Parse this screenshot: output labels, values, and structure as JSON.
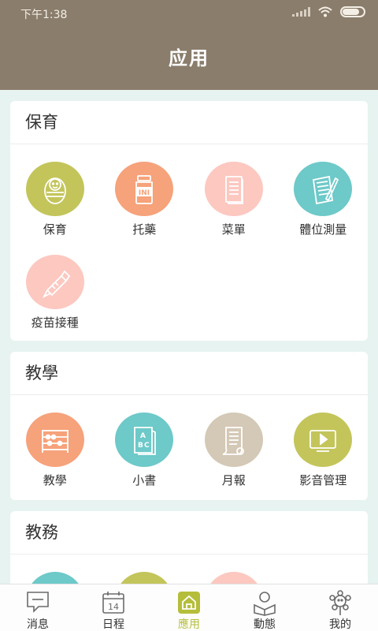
{
  "status": {
    "time": "下午1:38"
  },
  "header": {
    "title": "应用"
  },
  "colors": {
    "header_bg": "#8a7d6c",
    "lime": "#c3c55b",
    "orange": "#f6a27b",
    "pink": "#fcc8c0",
    "teal": "#6ec9c9",
    "beige": "#d4c8b6",
    "active_tab": "#b5be3a"
  },
  "sections": [
    {
      "title": "保育",
      "items": [
        {
          "label": "保育",
          "icon": "baby-icon",
          "color": "#c3c55b"
        },
        {
          "label": "托藥",
          "icon": "medicine-bottle-icon",
          "color": "#f6a27b"
        },
        {
          "label": "菜單",
          "icon": "menu-book-icon",
          "color": "#fcc8c0"
        },
        {
          "label": "體位測量",
          "icon": "measure-notepad-icon",
          "color": "#6ec9c9"
        },
        {
          "label": "疫苗接種",
          "icon": "vaccine-icon",
          "color": "#fcc8c0"
        }
      ]
    },
    {
      "title": "教學",
      "items": [
        {
          "label": "教學",
          "icon": "abacus-icon",
          "color": "#f6a27b"
        },
        {
          "label": "小書",
          "icon": "abc-book-icon",
          "color": "#6ec9c9"
        },
        {
          "label": "月報",
          "icon": "scroll-report-icon",
          "color": "#d4c8b6"
        },
        {
          "label": "影音管理",
          "icon": "video-icon",
          "color": "#c3c55b"
        }
      ]
    },
    {
      "title": "教務",
      "items": [
        {
          "icon": "teal-app-icon",
          "color": "#6ec9c9"
        },
        {
          "icon": "lime-app-icon",
          "color": "#c3c55b"
        },
        {
          "icon": "pink-app-icon",
          "color": "#fcc8c0"
        }
      ]
    }
  ],
  "tabs": [
    {
      "label": "消息",
      "icon": "message-icon"
    },
    {
      "label": "日程",
      "icon": "calendar-icon",
      "day": "14"
    },
    {
      "label": "應用",
      "icon": "house-app-icon",
      "active": true
    },
    {
      "label": "動態",
      "icon": "reading-child-icon"
    },
    {
      "label": "我的",
      "icon": "flower-face-icon"
    }
  ]
}
